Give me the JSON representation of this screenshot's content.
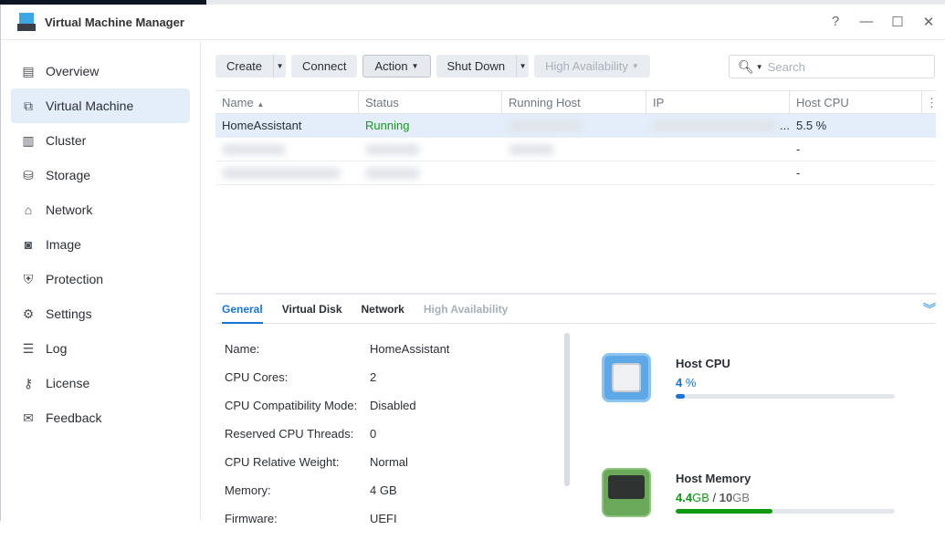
{
  "window": {
    "title": "Virtual Machine Manager",
    "controls": [
      "?",
      "—",
      "☐",
      "✕"
    ]
  },
  "sidebar": {
    "items": [
      {
        "label": "Overview",
        "icon": "overview-icon",
        "glyph": "▤"
      },
      {
        "label": "Virtual Machine",
        "icon": "virtual-machine-icon",
        "glyph": "⧉"
      },
      {
        "label": "Cluster",
        "icon": "cluster-icon",
        "glyph": "▥"
      },
      {
        "label": "Storage",
        "icon": "storage-icon",
        "glyph": "⛁"
      },
      {
        "label": "Network",
        "icon": "network-icon",
        "glyph": "⌂"
      },
      {
        "label": "Image",
        "icon": "image-icon",
        "glyph": "◙"
      },
      {
        "label": "Protection",
        "icon": "shield-icon",
        "glyph": "⛨"
      },
      {
        "label": "Settings",
        "icon": "gear-icon",
        "glyph": "⚙"
      },
      {
        "label": "Log",
        "icon": "log-icon",
        "glyph": "☰"
      },
      {
        "label": "License",
        "icon": "key-icon",
        "glyph": "⚷"
      },
      {
        "label": "Feedback",
        "icon": "feedback-icon",
        "glyph": "✉"
      }
    ]
  },
  "toolbar": {
    "create": "Create",
    "connect": "Connect",
    "action": "Action",
    "shutdown": "Shut Down",
    "ha": "High Availability",
    "search_placeholder": "Search"
  },
  "table": {
    "columns": [
      "Name",
      "Status",
      "Running Host",
      "IP",
      "Host CPU"
    ],
    "rows": [
      {
        "name": "HomeAssistant",
        "status": "Running",
        "cpu": "5.5 %",
        "ip_suffix": "..."
      },
      {
        "name": "",
        "status": "",
        "cpu": "-"
      },
      {
        "name": "",
        "status": "",
        "cpu": "-"
      }
    ]
  },
  "detail": {
    "tabs": [
      "General",
      "Virtual Disk",
      "Network",
      "High Availability"
    ],
    "props": [
      {
        "k": "Name:",
        "v": "HomeAssistant"
      },
      {
        "k": "CPU Cores:",
        "v": "2"
      },
      {
        "k": "CPU Compatibility Mode:",
        "v": "Disabled"
      },
      {
        "k": "Reserved CPU Threads:",
        "v": "0"
      },
      {
        "k": "CPU Relative Weight:",
        "v": "Normal"
      },
      {
        "k": "Memory:",
        "v": "4 GB"
      },
      {
        "k": "Firmware:",
        "v": "UEFI"
      }
    ],
    "cpu": {
      "label": "Host CPU",
      "value": "4",
      "unit": "%",
      "percent": 4,
      "color": "#1a73d9"
    },
    "memory": {
      "label": "Host Memory",
      "used": "4.4",
      "used_unit": "GB",
      "sep": "/",
      "total": "10",
      "total_unit": "GB",
      "percent": 44,
      "color": "#0f9b0f"
    }
  }
}
